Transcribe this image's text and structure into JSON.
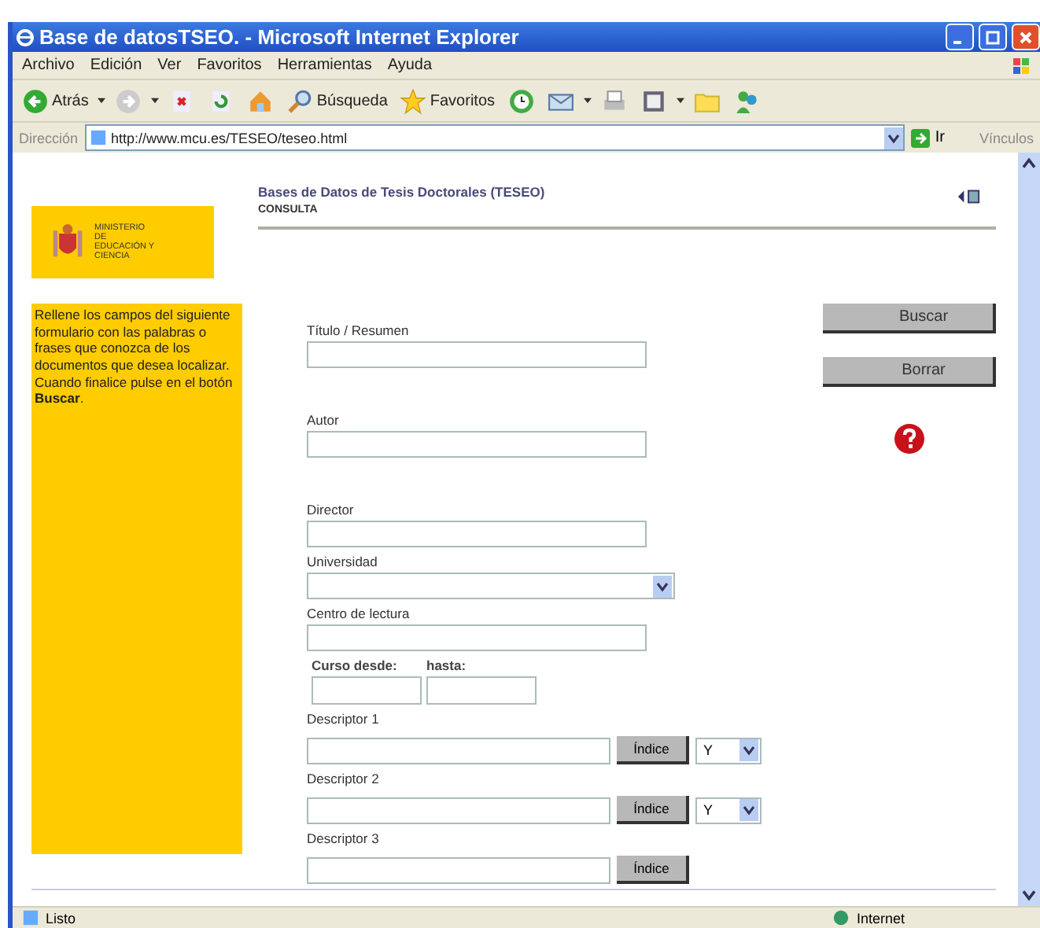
{
  "window": {
    "title": "Base de datosTSEO. - Microsoft Internet Explorer"
  },
  "menu": [
    "Archivo",
    "Edición",
    "Ver",
    "Favoritos",
    "Herramientas",
    "Ayuda"
  ],
  "toolbar": [
    {
      "kind": "back",
      "label": "Atrás"
    },
    {
      "kind": "forward"
    },
    {
      "kind": "stop"
    },
    {
      "kind": "refresh"
    },
    {
      "kind": "home"
    },
    {
      "kind": "search",
      "label": "Búsqueda"
    },
    {
      "kind": "favorites",
      "label": "Favoritos"
    },
    {
      "kind": "history"
    },
    {
      "kind": "mail"
    },
    {
      "kind": "print"
    },
    {
      "kind": "edit"
    },
    {
      "kind": "folder"
    },
    {
      "kind": "messenger"
    }
  ],
  "address": {
    "label": "Dirección",
    "url": "http://www.mcu.es/TESEO/teseo.html",
    "go": "Ir",
    "links": "Vínculos"
  },
  "page": {
    "logo_text": "MINISTERIO DE EDUCACIÓN Y CIENCIA",
    "title": "Bases de Datos de Tesis Doctorales (TESEO)",
    "subtitle": "CONSULTA",
    "instructions": "Rellene los campos del siguiente formulario con las palabras o frases que conozca de los documentos que desea localizar. Cuando finalice pulse en el botón **Buscar**.",
    "fields": [
      {
        "kind": "text",
        "label": "Título / Resumen"
      },
      {
        "kind": "text",
        "label": "Autor"
      },
      {
        "kind": "text",
        "label": "Director"
      },
      {
        "kind": "select",
        "label": "Universidad"
      },
      {
        "kind": "text",
        "label": "Centro de lectura"
      },
      {
        "kind": "range",
        "labels": [
          "Curso desde:",
          "hasta:"
        ]
      },
      {
        "kind": "descriptor",
        "label": "Descriptor 1",
        "button": "Índice",
        "operator": "Y"
      },
      {
        "kind": "descriptor",
        "label": "Descriptor 2",
        "button": "Índice",
        "operator": "Y"
      },
      {
        "kind": "descriptor",
        "label": "Descriptor 3",
        "button": "Índice"
      }
    ],
    "buttons": [
      "Buscar",
      "Borrar"
    ]
  },
  "status_bar": {
    "text": "Listo",
    "zone": "Internet"
  }
}
